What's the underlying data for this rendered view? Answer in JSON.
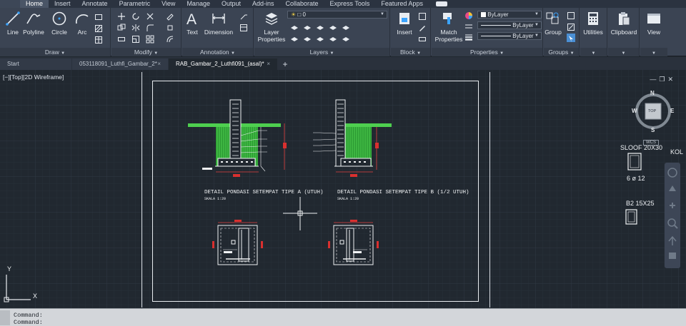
{
  "tabs": [
    "Home",
    "Insert",
    "Annotate",
    "Parametric",
    "View",
    "Manage",
    "Output",
    "Add-ins",
    "Collaborate",
    "Express Tools",
    "Featured Apps"
  ],
  "ribbon": {
    "draw": {
      "title": "Draw",
      "line": "Line",
      "polyline": "Polyline",
      "circle": "Circle",
      "arc": "Arc"
    },
    "modify": {
      "title": "Modify"
    },
    "annotation": {
      "title": "Annotation",
      "text": "Text",
      "dimension": "Dimension"
    },
    "layers": {
      "title": "Layers",
      "layer_properties": "Layer\nProperties",
      "layer_value": "0"
    },
    "block": {
      "title": "Block",
      "insert": "Insert"
    },
    "properties": {
      "title": "Properties",
      "match": "Match\nProperties",
      "color": "ByLayer",
      "linetype": "ByLayer",
      "lineweight": "ByLayer"
    },
    "groups": {
      "title": "Groups",
      "group": "Group"
    },
    "utilities": {
      "label": "Utilities"
    },
    "clipboard": {
      "label": "Clipboard"
    },
    "view": {
      "label": "View"
    }
  },
  "file_tabs": [
    {
      "label": "Start"
    },
    {
      "label": "053118091_Luthfi_Gambar_2*"
    },
    {
      "label": "RAB_Gambar_2_Luthfi091_(asal)*"
    }
  ],
  "viewport": {
    "label": "[−][Top][2D Wireframe]"
  },
  "drawing": {
    "caption_a": "DETAIL PONDASI SETEMPAT TIPE A (UTUH)",
    "caption_b": "DETAIL PONDASI SETEMPAT TIPE B (1/2 UTUH)",
    "scale_a": "SKALA 1:20",
    "scale_b": "SKALA 1:20",
    "sloof_label": "SLOOF 20X30",
    "sloof_rebar": "6 ø 12",
    "b2_label": "B2 15X25",
    "kol_label": "KOL"
  },
  "viewcube": {
    "n": "N",
    "s": "S",
    "e": "E",
    "w": "W",
    "top": "TOP",
    "wcs": "WCS"
  },
  "ucs": {
    "x": "X",
    "y": "Y"
  },
  "command": {
    "line1": "Command:",
    "line2": "Command:"
  },
  "colors": {
    "accent": "#c6c8ca",
    "canvas": "#212830",
    "hatch": "#36b23a",
    "dimension": "#d9302f",
    "bar_text": "#ffffff"
  }
}
